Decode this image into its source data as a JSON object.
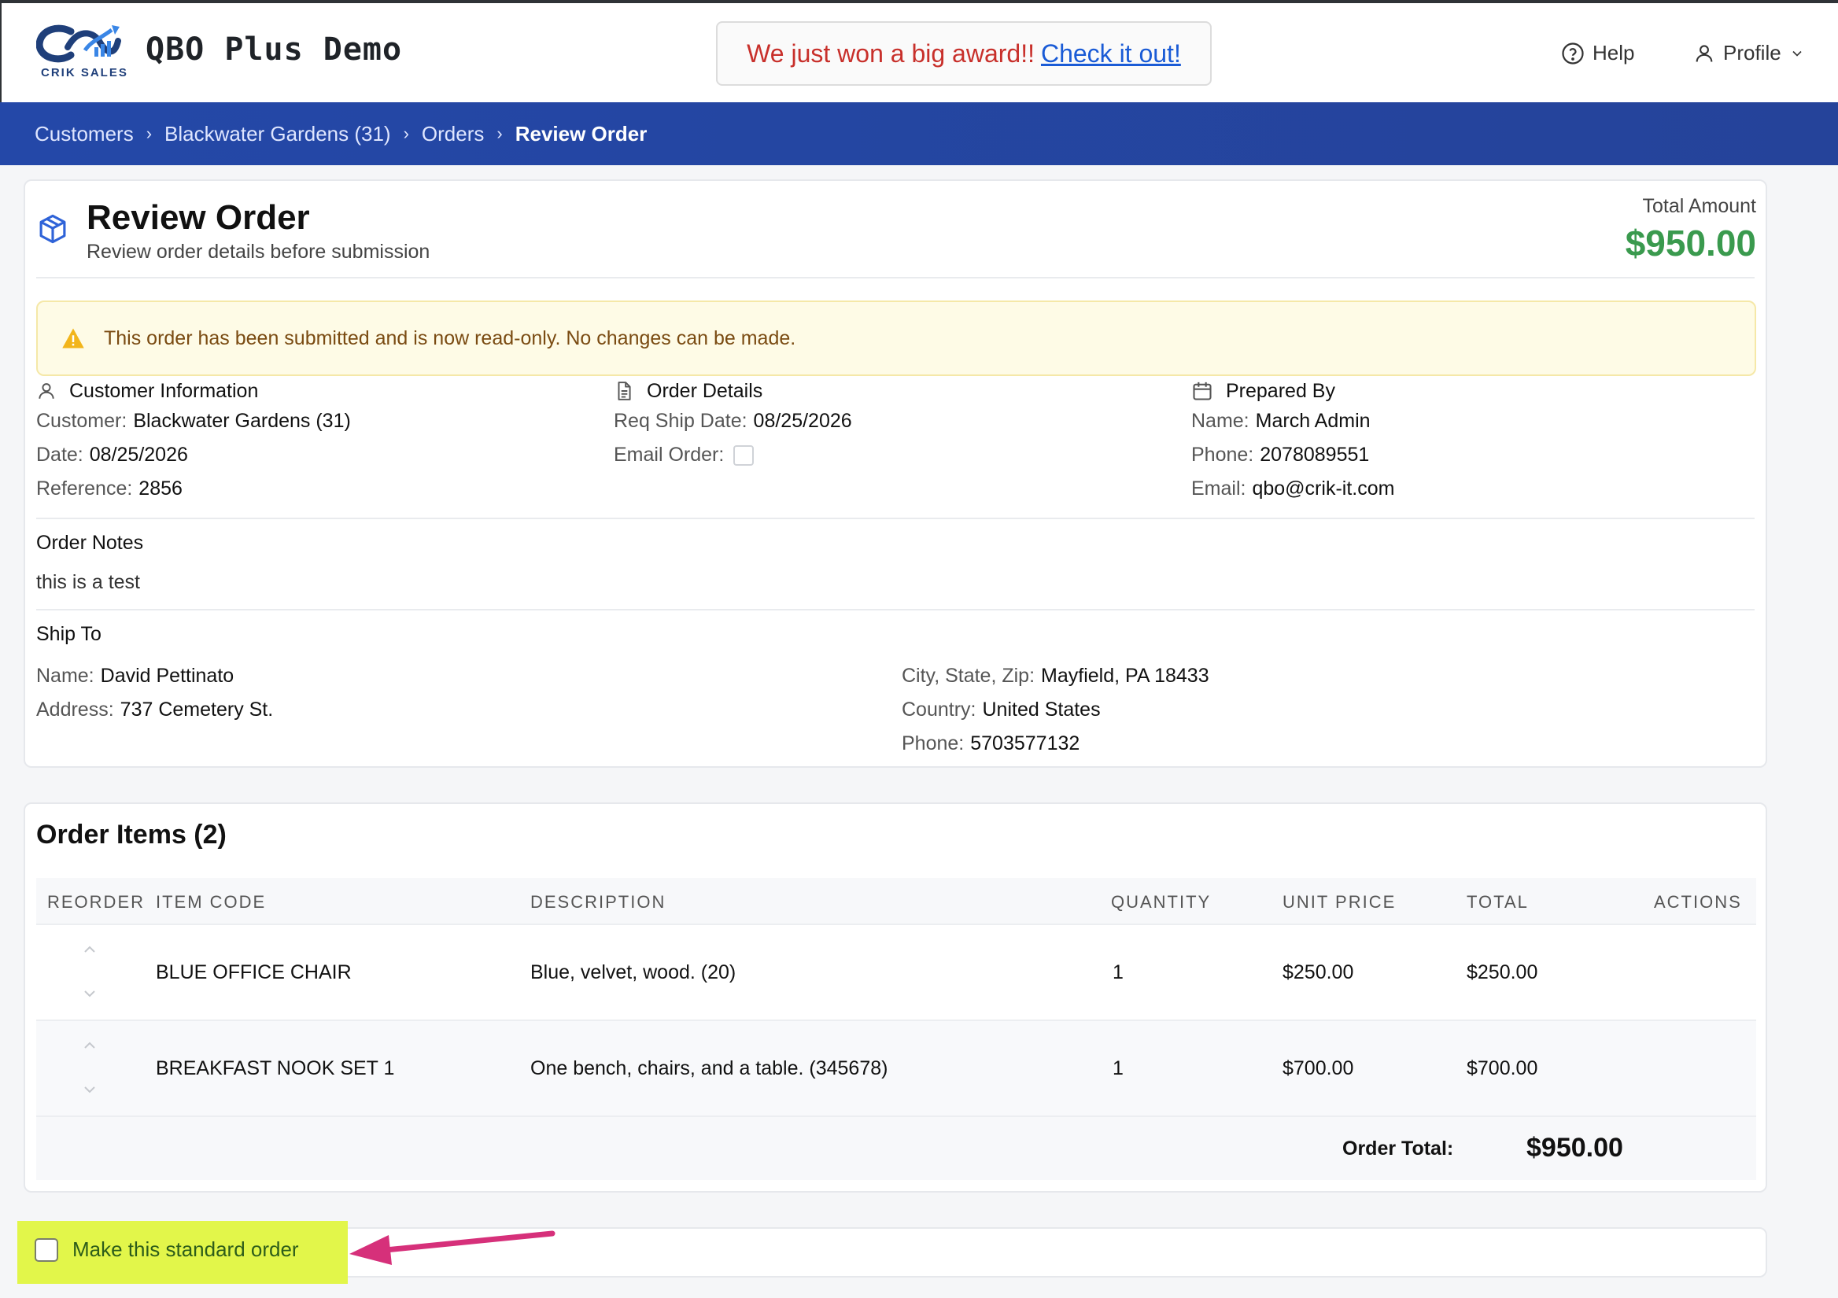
{
  "app": {
    "logo_text": "CRIK SALES",
    "title": "QBO Plus Demo",
    "award_message": "We just won a big award!!",
    "award_link": "Check it out!",
    "help_label": "Help",
    "profile_label": "Profile"
  },
  "breadcrumb": {
    "items": [
      "Customers",
      "Blackwater Gardens (31)",
      "Orders"
    ],
    "current": "Review Order",
    "separator": "›"
  },
  "review": {
    "title": "Review Order",
    "subtitle": "Review order details before submission",
    "total_label": "Total Amount",
    "total_amount": "$950.00",
    "alert": "This order has been submitted and is now read-only. No changes can be made."
  },
  "customer_info": {
    "heading": "Customer Information",
    "customer_label": "Customer:",
    "customer_value": "Blackwater Gardens (31)",
    "date_label": "Date:",
    "date_value": "08/25/2026",
    "reference_label": "Reference:",
    "reference_value": "2856"
  },
  "order_details": {
    "heading": "Order Details",
    "ship_date_label": "Req Ship Date:",
    "ship_date_value": "08/25/2026",
    "email_order_label": "Email Order:"
  },
  "prepared_by": {
    "heading": "Prepared By",
    "name_label": "Name:",
    "name_value": "March Admin",
    "phone_label": "Phone:",
    "phone_value": "2078089551",
    "email_label": "Email:",
    "email_value": "qbo@crik-it.com"
  },
  "notes": {
    "heading": "Order Notes",
    "value": "this is a test"
  },
  "ship_to": {
    "heading": "Ship To",
    "name_label": "Name:",
    "name_value": "David Pettinato",
    "address_label": "Address:",
    "address_value": "737 Cemetery St.",
    "csz_label": "City, State, Zip:",
    "csz_value": "Mayfield, PA 18433",
    "country_label": "Country:",
    "country_value": "United States",
    "phone_label": "Phone:",
    "phone_value": "5703577132"
  },
  "items": {
    "title": "Order Items (2)",
    "columns": [
      "REORDER",
      "ITEM CODE",
      "DESCRIPTION",
      "QUANTITY",
      "UNIT PRICE",
      "TOTAL",
      "ACTIONS"
    ],
    "rows": [
      {
        "code": "BLUE OFFICE CHAIR",
        "description": "Blue, velvet, wood. (20)",
        "quantity": "1",
        "unit_price": "$250.00",
        "total": "$250.00"
      },
      {
        "code": "BREAKFAST NOOK SET 1",
        "description": "One bench, chairs, and a table. (345678)",
        "quantity": "1",
        "unit_price": "$700.00",
        "total": "$700.00"
      }
    ],
    "order_total_label": "Order Total:",
    "order_total_value": "$950.00"
  },
  "standard_order": {
    "label": "Make this standard order"
  },
  "colors": {
    "brand_blue": "#2448a8",
    "total_green": "#3a9a4e",
    "alert_bg": "#fefbe6",
    "highlight": "#e2f64a",
    "annotation_arrow": "#d6307a"
  }
}
